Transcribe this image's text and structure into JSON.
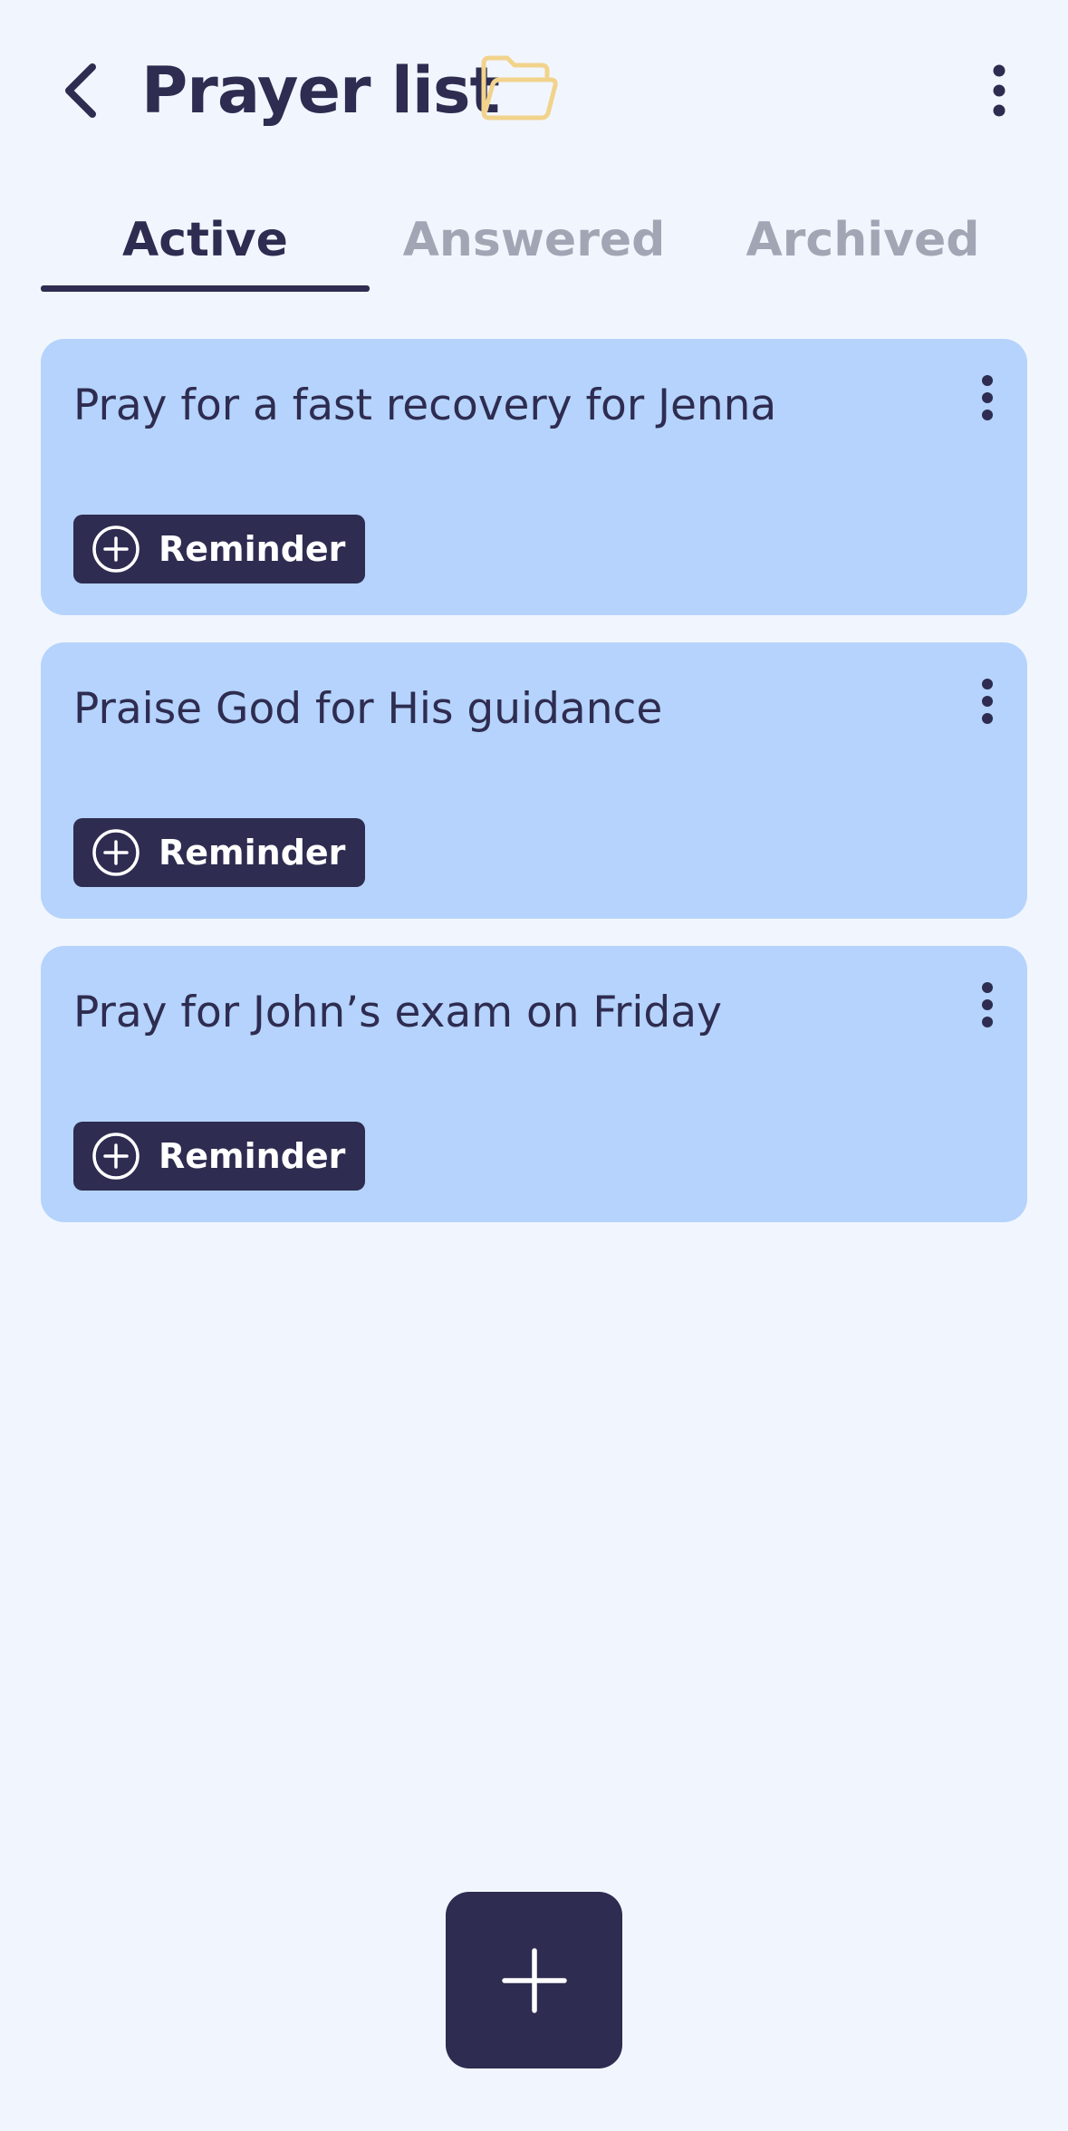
{
  "header": {
    "title": "Prayer list",
    "back_icon": "chevron-left-icon",
    "folder_icon": "folder-open-icon",
    "more_icon": "more-vertical-icon"
  },
  "tabs": [
    {
      "label": "Active",
      "selected": true
    },
    {
      "label": "Answered",
      "selected": false
    },
    {
      "label": "Archived",
      "selected": false
    }
  ],
  "prayers": [
    {
      "text": "Pray for a fast recovery for Jenna",
      "reminder_label": "Reminder"
    },
    {
      "text": "Praise God for His guidance",
      "reminder_label": "Reminder"
    },
    {
      "text": "Pray for John’s exam on Friday",
      "reminder_label": "Reminder"
    }
  ],
  "fab": {
    "icon": "plus-icon"
  },
  "colors": {
    "background": "#F1F6FE",
    "primary": "#2E2C50",
    "card": "#B5D3FC",
    "tab_inactive": "#A2A6B4",
    "folder_accent": "#F2D38C"
  }
}
